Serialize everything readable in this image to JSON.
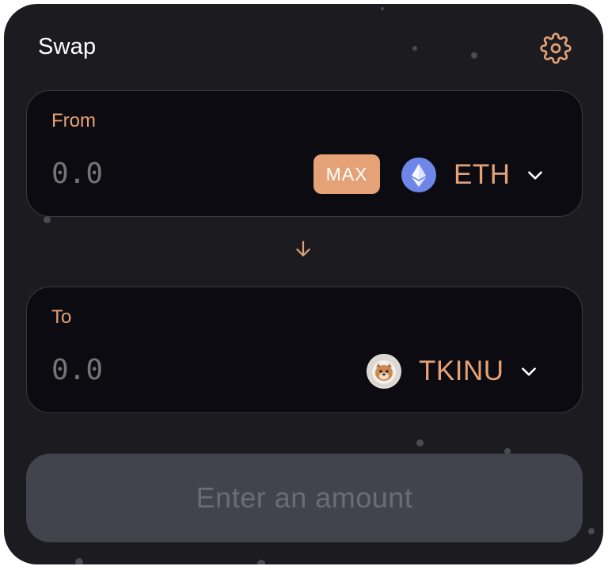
{
  "header": {
    "title": "Swap",
    "settings_icon": "gear-icon"
  },
  "from_panel": {
    "label": "From",
    "amount_placeholder": "0.0",
    "max_label": "MAX",
    "token": {
      "symbol": "ETH",
      "icon": "ethereum-icon"
    }
  },
  "direction_icon": "arrow-down-icon",
  "to_panel": {
    "label": "To",
    "amount_placeholder": "0.0",
    "token": {
      "symbol": "TKINU",
      "icon": "tkinu-token-icon"
    }
  },
  "submit_button": {
    "label": "Enter an amount",
    "disabled": true
  },
  "colors": {
    "card_background": "#1c1b20",
    "panel_background": "#0d0b12",
    "accent": "#e5a277",
    "ethereum_blue": "#6f86e9",
    "disabled_button": "#43434d",
    "disabled_text": "#6c6c78",
    "placeholder_text": "#5b5b66"
  }
}
